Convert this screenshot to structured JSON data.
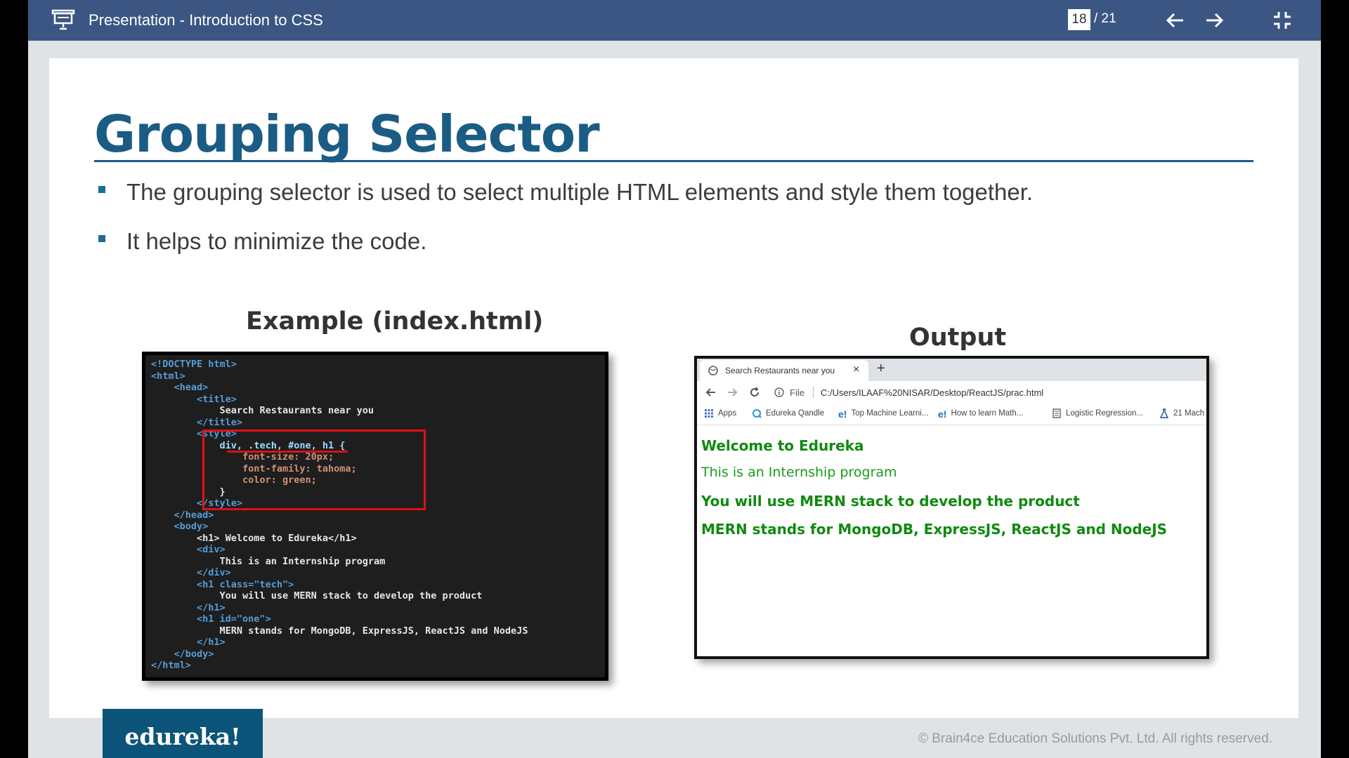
{
  "topbar": {
    "title": "Presentation - Introduction to CSS",
    "current_page": "18",
    "total_pages": "/ 21",
    "icons": [
      "presentation-icon",
      "arrow-left-icon",
      "arrow-right-icon",
      "exit-fullscreen-icon"
    ]
  },
  "slide": {
    "title": "Grouping Selector",
    "bullets": [
      "The grouping selector is used to select multiple HTML elements and style them together.",
      "It helps to minimize the code."
    ],
    "example_heading": "Example (index.html)",
    "output_heading": "Output",
    "code_lines": [
      "<!DOCTYPE html>",
      "<html>",
      "<head>",
      "<title>",
      "Search Restaurants near you",
      "</title>",
      "<style>",
      "div, .tech, #one, h1 {",
      "font-size: 20px;",
      "font-family: tahoma;",
      "color: green;",
      "}",
      "</style>",
      "</head>",
      "<body>",
      "<h1> Welcome to Edureka</h1>",
      "<div>",
      "This is an Internship program",
      "</div>",
      "<h1 class=\"tech\">",
      "You will use MERN stack to develop the product",
      "</h1>",
      "<h1 id=\"one\">",
      "MERN stands for MongoDB, ExpressJS, ReactJS and NodeJS",
      "</h1>",
      "</body>",
      "</html>"
    ],
    "browser": {
      "tab_title": "Search Restaurants near you",
      "tab_close": "×",
      "new_tab": "+",
      "file_label": "File",
      "url": "C:/Users/ILAAF%20NISAR/Desktop/ReactJS/prac.html",
      "bookmarks": [
        "Apps",
        "Edureka Qandle",
        "Top Machine Learni...",
        "How to learn Math...",
        "Logistic Regression...",
        "21 Mach"
      ],
      "content": [
        "Welcome to Edureka",
        "This is an Internship program",
        "You will use MERN stack to develop the product",
        "MERN stands for MongoDB, ExpressJS, ReactJS and NodeJS"
      ],
      "text_color": "#1a9c1a"
    }
  },
  "footer": {
    "logo": "edureka!",
    "copyright": "© Brain4ce Education Solutions Pvt. Ltd. All rights reserved."
  },
  "colors": {
    "topbar": "#3b5683",
    "title": "#1b5c84",
    "logo_bg": "#0c5479",
    "highlight": "#e01010"
  }
}
